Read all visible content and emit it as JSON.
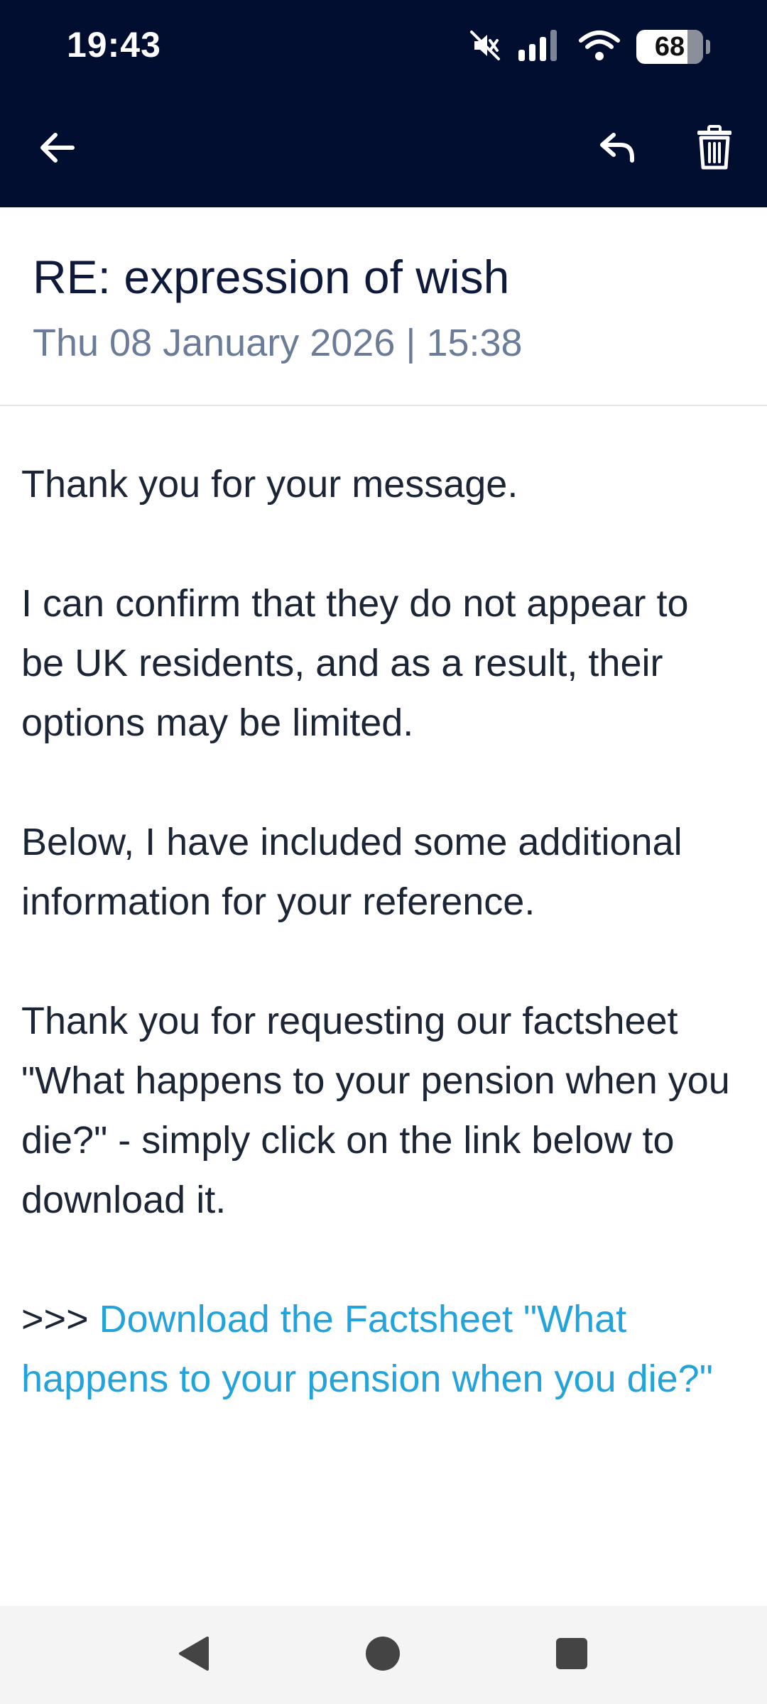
{
  "status_bar": {
    "time": "19:43",
    "battery_level": "68",
    "icons": [
      "mute-icon",
      "signal-icon",
      "wifi-icon",
      "battery-icon"
    ]
  },
  "app_bar": {
    "icons": [
      "back-arrow-icon",
      "reply-icon",
      "trash-icon"
    ]
  },
  "message": {
    "subject": "RE: expression of wish",
    "date": "Thu 08 January 2026",
    "separator": "|",
    "time": "15:38",
    "paragraphs": [
      "Thank you for your message.",
      "I can confirm that they do not appear to be UK residents, and as a result, their options may be limited.",
      "Below, I have included some additional information for your reference.",
      "Thank you for requesting our factsheet \"What happens to your pension when you die?\" - simply click on the link below to download it."
    ],
    "link_prefix": ">>> ",
    "link_text": "Download the Factsheet \"What happens to your pension when you die?\""
  },
  "colors": {
    "header_bg": "#020e2f",
    "link": "#23a3dc",
    "meta_text": "#6b7c98"
  },
  "nav_bar": {
    "icons": [
      "back-triangle-icon",
      "home-circle-icon",
      "recents-square-icon"
    ]
  }
}
